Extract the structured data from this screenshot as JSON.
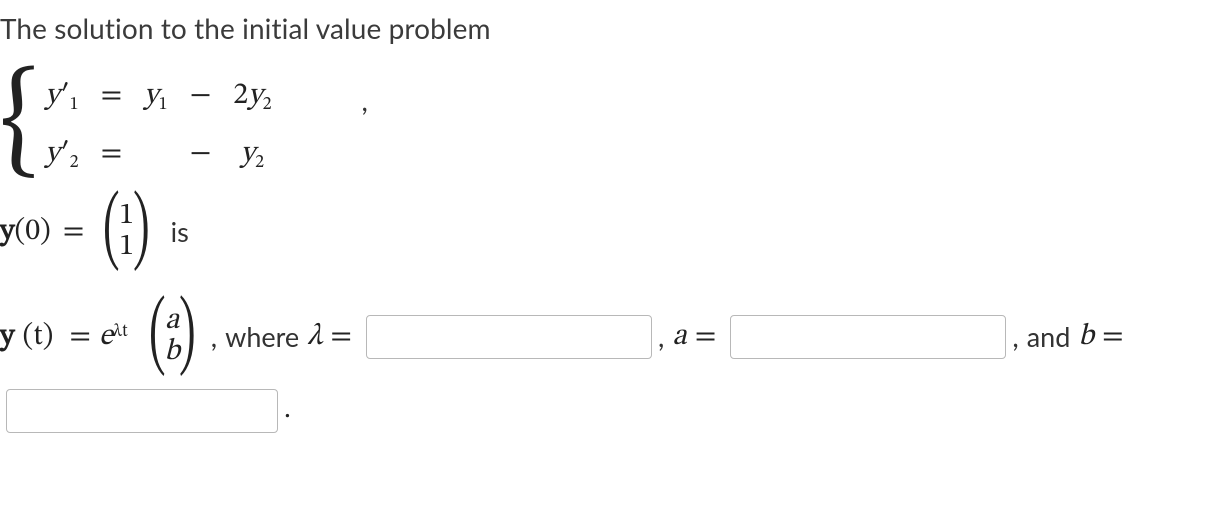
{
  "prompt": "The solution to the initial value problem",
  "system": {
    "lhs1": "y",
    "p1": "′",
    "s1": "1",
    "eq": "=",
    "r1c1": "y",
    "r1c1s": "1",
    "minus": "−",
    "r1c2_coef": "2",
    "r1c2_y": "y",
    "r1c2_s": "2",
    "lhs2": "y",
    "p2": "′",
    "s2": "2",
    "r2c1": "",
    "r2c2_y": "y",
    "r2c2_s": "2",
    "trailing_comma": ","
  },
  "initial": {
    "y": "y",
    "zero": "(0)",
    "eq": "=",
    "v_top": "1",
    "v_bot": "1",
    "is": "is"
  },
  "solution": {
    "y": "y",
    "arg": "(t)",
    "eq": "=",
    "exp_e": "e",
    "exp_power_lambda": "λ",
    "exp_power_t": "t",
    "v_top": "a",
    "v_bot": "b",
    "comma1": ",",
    "where": "where",
    "lambda": "λ",
    "eq2": "=",
    "comma2": ",",
    "a": "a",
    "eq3": "=",
    "comma3": ",",
    "and": "and",
    "b": "b",
    "eq4": "=",
    "period": "."
  },
  "inputs": {
    "lambda_value": "",
    "a_value": "",
    "b_value": ""
  }
}
